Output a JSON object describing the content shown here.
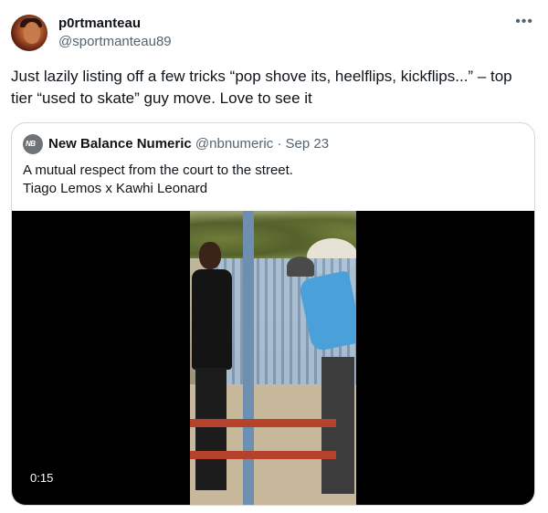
{
  "tweet": {
    "display_name": "p0rtmanteau",
    "handle": "@sportmanteau89",
    "more_icon": "more-icon",
    "text": "Just lazily listing off a few tricks “pop shove its, heelflips, kickflips...” – top tier “used to skate” guy move. Love to see it"
  },
  "quoted": {
    "display_name": "New Balance Numeric",
    "handle": "@nbnumeric",
    "separator": "·",
    "date": "Sep 23",
    "avatar_logo": "NB",
    "text_line1": "A mutual respect from the court to the street.",
    "text_line2": "Tiago Lemos x Kawhi Leonard",
    "video": {
      "duration": "0:15"
    }
  },
  "colors": {
    "text_primary": "#0f1419",
    "text_secondary": "#536471",
    "border": "#cfd9de",
    "video_bg": "#000000"
  }
}
